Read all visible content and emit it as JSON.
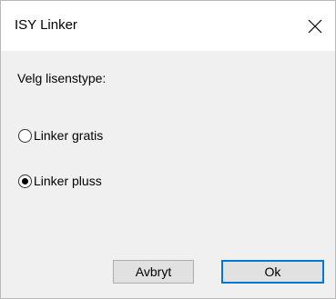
{
  "window": {
    "title": "ISY Linker"
  },
  "content": {
    "prompt": "Velg lisenstype:",
    "options": [
      {
        "label": "Linker gratis",
        "checked": false
      },
      {
        "label": "Linker pluss",
        "checked": true
      }
    ]
  },
  "buttons": {
    "cancel_label": "Avbryt",
    "ok_label": "Ok"
  },
  "icons": {
    "close": "close-icon",
    "radio_unchecked": "radio-unchecked-icon",
    "radio_checked": "radio-checked-icon"
  },
  "colors": {
    "accent": "#0078d7",
    "dialog_background": "#f0f0f0",
    "titlebar_background": "#ffffff"
  }
}
